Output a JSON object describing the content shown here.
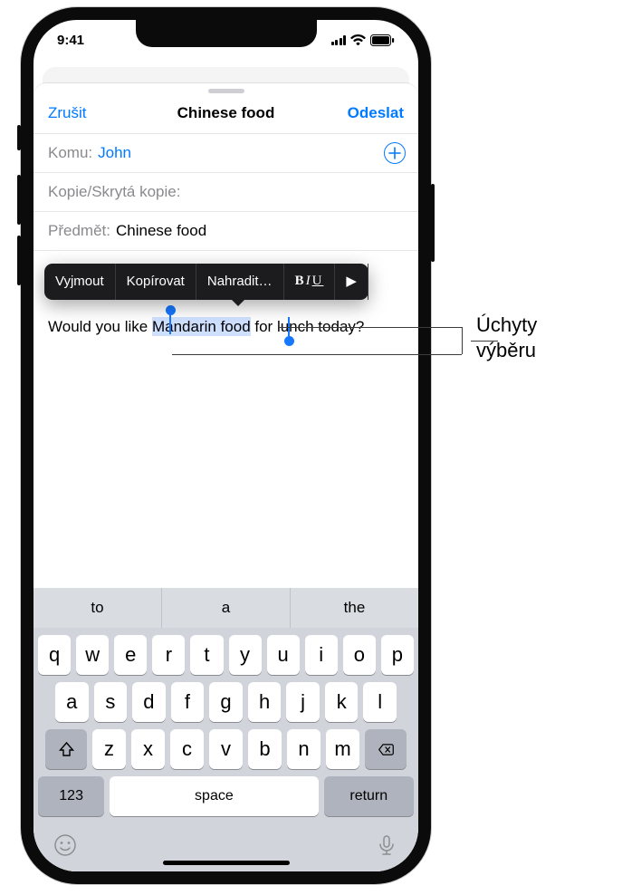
{
  "status": {
    "time": "9:41"
  },
  "nav": {
    "cancel": "Zrušit",
    "title": "Chinese food",
    "send": "Odeslat"
  },
  "fields": {
    "to_label": "Komu:",
    "to_value": "John",
    "cc_label": "Kopie/Skrytá kopie:",
    "subject_label": "Předmět:",
    "subject_value": "Chinese food"
  },
  "body": {
    "pre": "Would you like ",
    "selected": "Mandarin food",
    "post": " for lunch today?"
  },
  "editmenu": {
    "cut": "Vyjmout",
    "copy": "Kopírovat",
    "replace": "Nahradit…",
    "biu_b": "B",
    "biu_i": "I",
    "biu_u": "U",
    "more": "▶"
  },
  "predict": {
    "a": "to",
    "b": "a",
    "c": "the"
  },
  "keys": {
    "r1": [
      "q",
      "w",
      "e",
      "r",
      "t",
      "y",
      "u",
      "i",
      "o",
      "p"
    ],
    "r2": [
      "a",
      "s",
      "d",
      "f",
      "g",
      "h",
      "j",
      "k",
      "l"
    ],
    "r3": [
      "z",
      "x",
      "c",
      "v",
      "b",
      "n",
      "m"
    ],
    "k123": "123",
    "space": "space",
    "return": "return"
  },
  "callout": {
    "line1": "Úchyty",
    "line2": "výběru"
  }
}
